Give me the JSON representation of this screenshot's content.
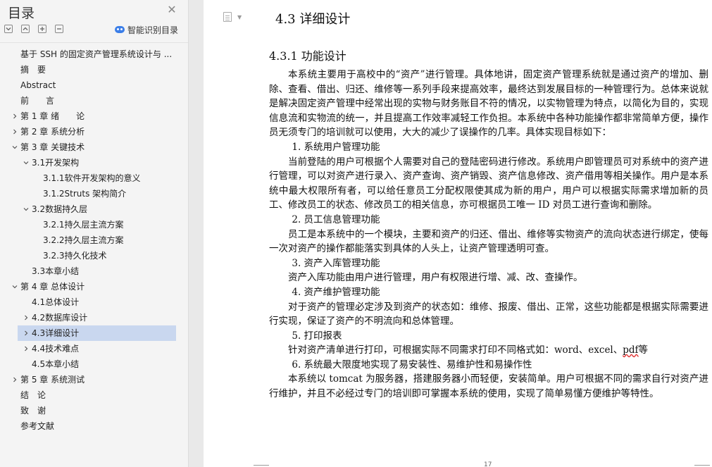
{
  "sidebar": {
    "title": "目录",
    "smart_recognize": "智能识别目录",
    "items": [
      {
        "label": "基于 SSH 的固定资产管理系统设计与 ..."
      },
      {
        "label": "摘　要"
      },
      {
        "label": "Abstract"
      },
      {
        "label": "前　　言"
      },
      {
        "label": "第 1 章  绪　　论"
      },
      {
        "label": "第 2 章  系统分析"
      },
      {
        "label": "第 3 章  关键技术"
      },
      {
        "label": "3.1开发架构"
      },
      {
        "label": "3.1.1软件开发架构的意义"
      },
      {
        "label": "3.1.2Struts 架构简介"
      },
      {
        "label": "3.2数据持久层"
      },
      {
        "label": "3.2.1持久层主流方案"
      },
      {
        "label": "3.2.2持久层主流方案"
      },
      {
        "label": "3.2.3持久化技术"
      },
      {
        "label": "3.3本章小结"
      },
      {
        "label": "第 4 章  总体设计"
      },
      {
        "label": "4.1总体设计"
      },
      {
        "label": "4.2数据库设计"
      },
      {
        "label": "4.3详细设计"
      },
      {
        "label": "4.4技术难点"
      },
      {
        "label": "4.5本章小结"
      },
      {
        "label": "第 5 章  系统测试"
      },
      {
        "label": "结　论"
      },
      {
        "label": "致　谢"
      },
      {
        "label": "参考文献"
      }
    ]
  },
  "document": {
    "section_title": "4.3  详细设计",
    "subsection_title": "4.3.1  功能设计",
    "intro": "本系统主要用于高校中的“资产”进行管理。具体地讲，固定资产管理系统就是通过资产的增加、删除、查看、借出、归还、维修等一系列手段来提高效率，最终达到发展目标的一种管理行为。总体来说就是解决固定资产管理中经常出现的实物与财务账目不符的情况，以实物管理为特点，以简化为目的，实现信息流和实物流的统一，并且提高工作效率减轻工作负担。本系统中各种功能操作都非常简单方便，操作员无须专门的培训就可以使用，大大的减少了误操作的几率。具体实现目标如下：",
    "item1_title": "1. 系统用户管理功能",
    "item1_text": "当前登陆的用户可根据个人需要对自己的登陆密码进行修改。系统用户即管理员可对系统中的资产进行管理，可以对资产进行录入、资产查询、资产销毁、资产信息修改、资产借用等相关操作。用户是本系统中最大权限所有者，可以给任意员工分配权限使其成为新的用户，用户可以根据实际需求增加新的员工、修改员工的状态、修改员工的相关信息，亦可根据员工唯一 ID 对员工进行查询和删除。",
    "item2_title": "2. 员工信息管理功能",
    "item2_text": "员工是本系统中的一个模块，主要和资产的归还、借出、维修等实物资产的流向状态进行绑定，使每一次对资产的操作都能落实到具体的人头上，让资产管理透明可查。",
    "item3_title": "3. 资产入库管理功能",
    "item3_text": "资产入库功能由用户进行管理，用户有权限进行增、减、改、查操作。",
    "item4_title": "4. 资产维护管理功能",
    "item4_text": "对于资产的管理必定涉及到资产的状态如：维修、报废、借出、正常，这些功能都是根据实际需要进行实现，保证了资产的不明流向和总体管理。",
    "item5_title": "5. 打印报表",
    "item5_text_a": "针对资产清单进行打印，可根据实际不同需求打印不同格式如：word、excel、",
    "item5_text_pdf": "pdf",
    "item5_text_b": "等",
    "item6_title": "6. 系统最大限度地实现了易安装性、易维护性和易操作性",
    "item6_text": "本系统以 tomcat 为服务器，搭建服务器小而轻便，安装简单。用户可根据不同的需求自行对资产进行维护，并且不必经过专门的培训即可掌握本系统的使用，实现了简单易懂方便维护等特性。",
    "page_number": "17"
  }
}
